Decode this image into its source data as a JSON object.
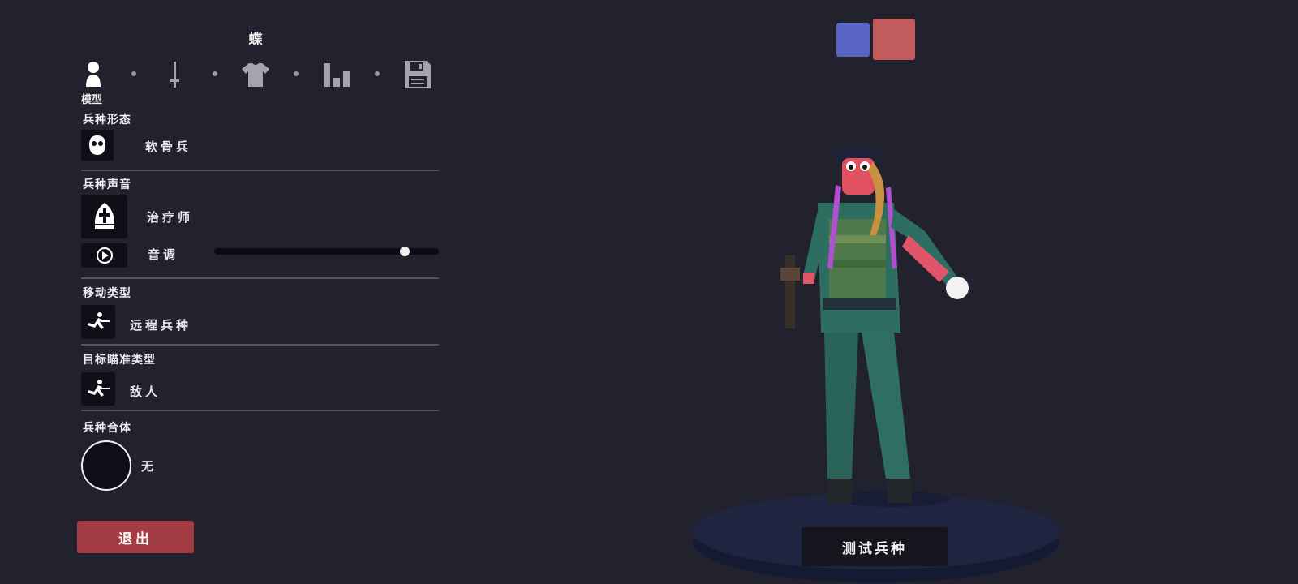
{
  "unit_name": "蝶",
  "tabs": [
    {
      "icon": "person-icon",
      "label": "模型",
      "active": true
    },
    {
      "icon": "sword-icon",
      "active": false
    },
    {
      "icon": "shirt-icon",
      "active": false
    },
    {
      "icon": "stats-icon",
      "active": false
    },
    {
      "icon": "save-icon",
      "active": false
    }
  ],
  "sections": {
    "form": {
      "title": "兵种形态",
      "value": "软骨兵",
      "icon": "mask-face-icon"
    },
    "voice": {
      "title": "兵种声音",
      "value": "治疗师",
      "icon": "bishop-hat-icon",
      "pitch_label": "音调",
      "pitch_level": 0.85
    },
    "movement": {
      "title": "移动类型",
      "value": "远程兵种",
      "icon": "ranged-unit-icon"
    },
    "targeting": {
      "title": "目标瞄准类型",
      "value": "敌人",
      "icon": "target-unit-icon"
    },
    "combine": {
      "title": "兵种合体",
      "value": "无",
      "icon": "empty-circle-icon"
    }
  },
  "team_colors": {
    "blue": "#5a66c4",
    "red": "#c25c5c"
  },
  "buttons": {
    "exit": "退出",
    "test": "测试兵种"
  },
  "colors": {
    "background": "#22212e",
    "exit_button": "#a23c42",
    "platform": "#1f2540"
  }
}
